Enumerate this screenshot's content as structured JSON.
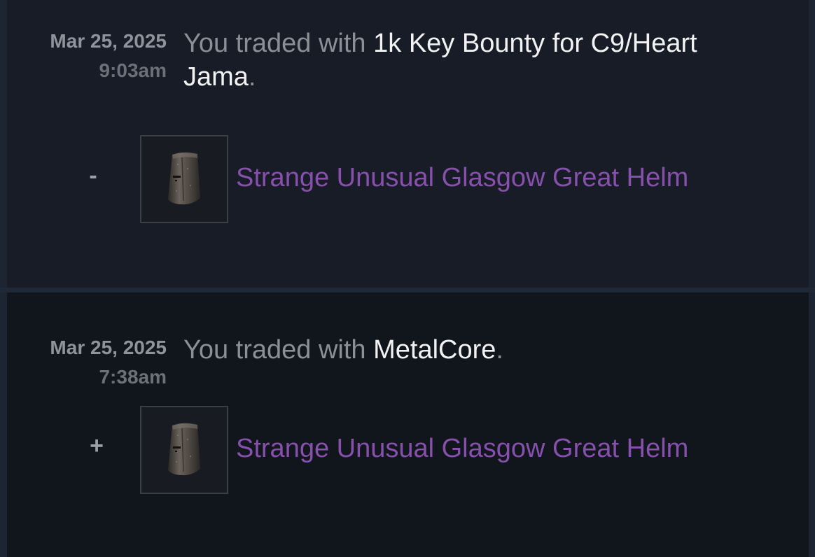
{
  "trades": [
    {
      "date": "Mar 25, 2025",
      "time": "9:03am",
      "prefix": "You traded with ",
      "partner": "1k Key Bounty for C9/Heart Jama",
      "suffix": ".",
      "item": {
        "sign": "-",
        "name": "Strange Unusual Glasgow Great Helm",
        "icon": "great-helm-icon",
        "name_color": "#8650ac"
      }
    },
    {
      "date": "Mar 25, 2025",
      "time": "7:38am",
      "prefix": "You traded with ",
      "partner": "MetalCore",
      "suffix": ".",
      "item": {
        "sign": "+",
        "name": "Strange Unusual Glasgow Great Helm",
        "icon": "great-helm-icon",
        "name_color": "#8650ac"
      }
    }
  ]
}
